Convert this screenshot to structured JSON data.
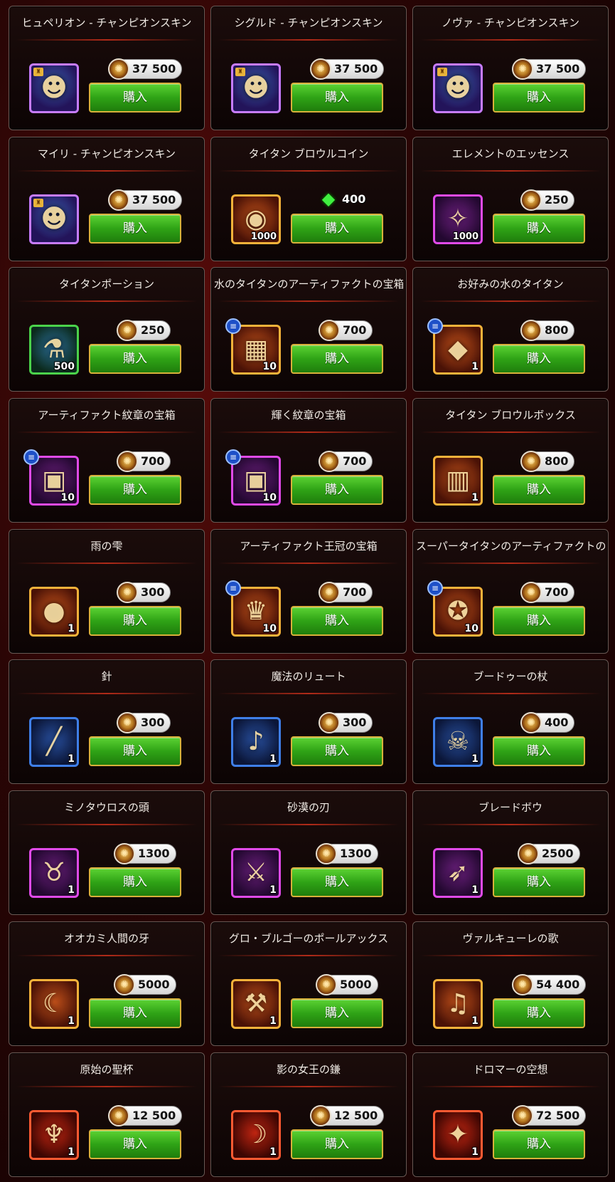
{
  "buy_label": "購入",
  "currency_icon": "coin-icon",
  "cards": [
    {
      "title": "ヒュペリオン - チャンピオンスキン",
      "price": "37 500",
      "currency": "coin",
      "qty": "",
      "icon": "champion-skin-icon",
      "frame": "purple",
      "hero_badge": true,
      "list_badge": false
    },
    {
      "title": "シグルド - チャンピオンスキン",
      "price": "37 500",
      "currency": "coin",
      "qty": "",
      "icon": "champion-skin-icon",
      "frame": "purple",
      "hero_badge": true,
      "list_badge": false
    },
    {
      "title": "ノヴァ - チャンピオンスキン",
      "price": "37 500",
      "currency": "coin",
      "qty": "",
      "icon": "champion-skin-icon",
      "frame": "purple",
      "hero_badge": true,
      "list_badge": false
    },
    {
      "title": "マイリ - チャンピオンスキン",
      "price": "37 500",
      "currency": "coin",
      "qty": "",
      "icon": "champion-skin-icon",
      "frame": "purple",
      "hero_badge": true,
      "list_badge": false
    },
    {
      "title": "タイタン ブロウルコイン",
      "price": "400",
      "currency": "emerald",
      "qty": "1000",
      "icon": "titan-brawl-coin-icon",
      "frame": "orange",
      "hero_badge": false,
      "list_badge": false
    },
    {
      "title": "エレメントのエッセンス",
      "price": "250",
      "currency": "coin",
      "qty": "1000",
      "icon": "element-essence-icon",
      "frame": "magenta",
      "hero_badge": false,
      "list_badge": false
    },
    {
      "title": "タイタンポーション",
      "price": "250",
      "currency": "coin",
      "qty": "500",
      "icon": "titan-potion-icon",
      "frame": "green",
      "hero_badge": false,
      "list_badge": false
    },
    {
      "title": "水のタイタンのアーティファクトの宝箱",
      "price": "700",
      "currency": "coin",
      "qty": "10",
      "icon": "water-titan-artifact-chest-icon",
      "frame": "orange",
      "hero_badge": false,
      "list_badge": true
    },
    {
      "title": "お好みの水のタイタン",
      "price": "800",
      "currency": "coin",
      "qty": "1",
      "icon": "water-titan-choice-icon",
      "frame": "orange",
      "hero_badge": false,
      "list_badge": true
    },
    {
      "title": "アーティファクト紋章の宝箱",
      "price": "700",
      "currency": "coin",
      "qty": "10",
      "icon": "artifact-emblem-chest-icon",
      "frame": "magenta",
      "hero_badge": false,
      "list_badge": true
    },
    {
      "title": "輝く紋章の宝箱",
      "price": "700",
      "currency": "coin",
      "qty": "10",
      "icon": "shining-emblem-chest-icon",
      "frame": "magenta",
      "hero_badge": false,
      "list_badge": true
    },
    {
      "title": "タイタン ブロウルボックス",
      "price": "800",
      "currency": "coin",
      "qty": "1",
      "icon": "titan-brawl-box-icon",
      "frame": "orange",
      "hero_badge": false,
      "list_badge": false
    },
    {
      "title": "雨の雫",
      "price": "300",
      "currency": "coin",
      "qty": "1",
      "icon": "raindrop-jar-icon",
      "frame": "orange",
      "hero_badge": false,
      "list_badge": false
    },
    {
      "title": "アーティファクト王冠の宝箱",
      "price": "700",
      "currency": "coin",
      "qty": "10",
      "icon": "artifact-crown-chest-icon",
      "frame": "orange",
      "hero_badge": false,
      "list_badge": true
    },
    {
      "title": "スーパータイタンのアーティファクトの宝箱",
      "price": "700",
      "currency": "coin",
      "qty": "10",
      "icon": "super-titan-artifact-chest-icon",
      "frame": "orange",
      "hero_badge": false,
      "list_badge": true
    },
    {
      "title": "針",
      "price": "300",
      "currency": "coin",
      "qty": "1",
      "icon": "needle-icon",
      "frame": "blue",
      "hero_badge": false,
      "list_badge": false
    },
    {
      "title": "魔法のリュート",
      "price": "300",
      "currency": "coin",
      "qty": "1",
      "icon": "magic-lute-icon",
      "frame": "blue",
      "hero_badge": false,
      "list_badge": false
    },
    {
      "title": "ブードゥーの杖",
      "price": "400",
      "currency": "coin",
      "qty": "1",
      "icon": "voodoo-staff-icon",
      "frame": "blue",
      "hero_badge": false,
      "list_badge": false
    },
    {
      "title": "ミノタウロスの頭",
      "price": "1300",
      "currency": "coin",
      "qty": "1",
      "icon": "minotaur-head-icon",
      "frame": "magenta",
      "hero_badge": false,
      "list_badge": false
    },
    {
      "title": "砂漠の刃",
      "price": "1300",
      "currency": "coin",
      "qty": "1",
      "icon": "desert-blade-icon",
      "frame": "magenta",
      "hero_badge": false,
      "list_badge": false
    },
    {
      "title": "ブレードボウ",
      "price": "2500",
      "currency": "coin",
      "qty": "1",
      "icon": "blade-bow-icon",
      "frame": "magenta",
      "hero_badge": false,
      "list_badge": false
    },
    {
      "title": "オオカミ人間の牙",
      "price": "5000",
      "currency": "coin",
      "qty": "1",
      "icon": "werewolf-fang-icon",
      "frame": "orange",
      "hero_badge": false,
      "list_badge": false
    },
    {
      "title": "グロ・ブルゴーのポールアックス",
      "price": "5000",
      "currency": "coin",
      "qty": "1",
      "icon": "poleaxe-icon",
      "frame": "orange",
      "hero_badge": false,
      "list_badge": false
    },
    {
      "title": "ヴァルキューレの歌",
      "price": "54 400",
      "currency": "coin",
      "qty": "1",
      "icon": "valkyrie-song-icon",
      "frame": "orange",
      "hero_badge": false,
      "list_badge": false
    },
    {
      "title": "原始の聖杯",
      "price": "12 500",
      "currency": "coin",
      "qty": "1",
      "icon": "primal-chalice-icon",
      "frame": "red",
      "hero_badge": false,
      "list_badge": false
    },
    {
      "title": "影の女王の鎌",
      "price": "12 500",
      "currency": "coin",
      "qty": "1",
      "icon": "shadow-queen-scythe-icon",
      "frame": "red",
      "hero_badge": false,
      "list_badge": false
    },
    {
      "title": "ドロマーの空想",
      "price": "72 500",
      "currency": "coin",
      "qty": "1",
      "icon": "dromar-fantasy-icon",
      "frame": "red",
      "hero_badge": false,
      "list_badge": false
    }
  ]
}
